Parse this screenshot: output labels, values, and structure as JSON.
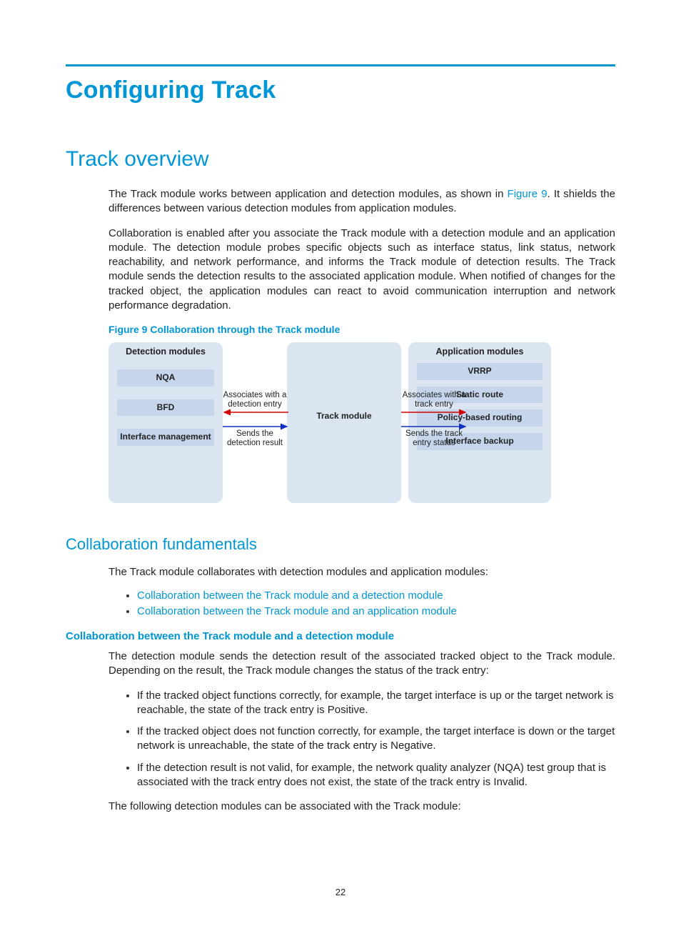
{
  "heading_h1": "Configuring Track",
  "heading_overview": "Track overview",
  "overview_p1_prefix": "The Track module works between application and detection modules, as shown in ",
  "overview_p1_link": "Figure 9",
  "overview_p1_suffix": ". It shields the differences between various detection modules from application modules.",
  "overview_p2": "Collaboration is enabled after you associate the Track module with a detection module and an application module. The detection module probes specific objects such as interface status, link status, network reachability, and network performance, and informs the Track module of detection results. The Track module sends the detection results to the associated application module. When notified of changes for the tracked object, the application modules can react to avoid communication interruption and network performance degradation.",
  "figure_caption": "Figure 9 Collaboration through the Track module",
  "diagram": {
    "detection_title": "Detection modules",
    "detection_items": [
      "NQA",
      "BFD",
      "Interface management"
    ],
    "track_module": "Track module",
    "application_title": "Application modules",
    "application_items": [
      "VRRP",
      "Static route",
      "Policy-based routing",
      "Interface backup"
    ],
    "label_assoc_detection": "Associates with a detection entry",
    "label_sends_detection": "Sends the detection result",
    "label_assoc_track": "Associates with a track entry",
    "label_sends_track": "Sends the track entry status"
  },
  "heading_fundamentals": "Collaboration fundamentals",
  "fundamentals_intro": "The Track module collaborates with detection modules and application modules:",
  "fundamentals_links": [
    "Collaboration between the Track module and a detection module",
    "Collaboration between the Track module and an application module"
  ],
  "heading_detection_collab": "Collaboration between the Track module and a detection module",
  "detection_intro": "The detection module sends the detection result of the associated tracked object to the Track module. Depending on the result, the Track module changes the status of the track entry:",
  "detection_bullets": [
    "If the tracked object functions correctly, for example, the target interface is up or the target network is reachable, the state of the track entry is Positive.",
    "If the tracked object does not function correctly, for example, the target interface is down or the target network is unreachable, the state of the track entry is Negative.",
    "If the detection result is not valid, for example, the network quality analyzer (NQA) test group that is associated with the track entry does not exist, the state of the track entry is Invalid."
  ],
  "detection_outro": "The following detection modules can be associated with the Track module:",
  "page_number": "22"
}
